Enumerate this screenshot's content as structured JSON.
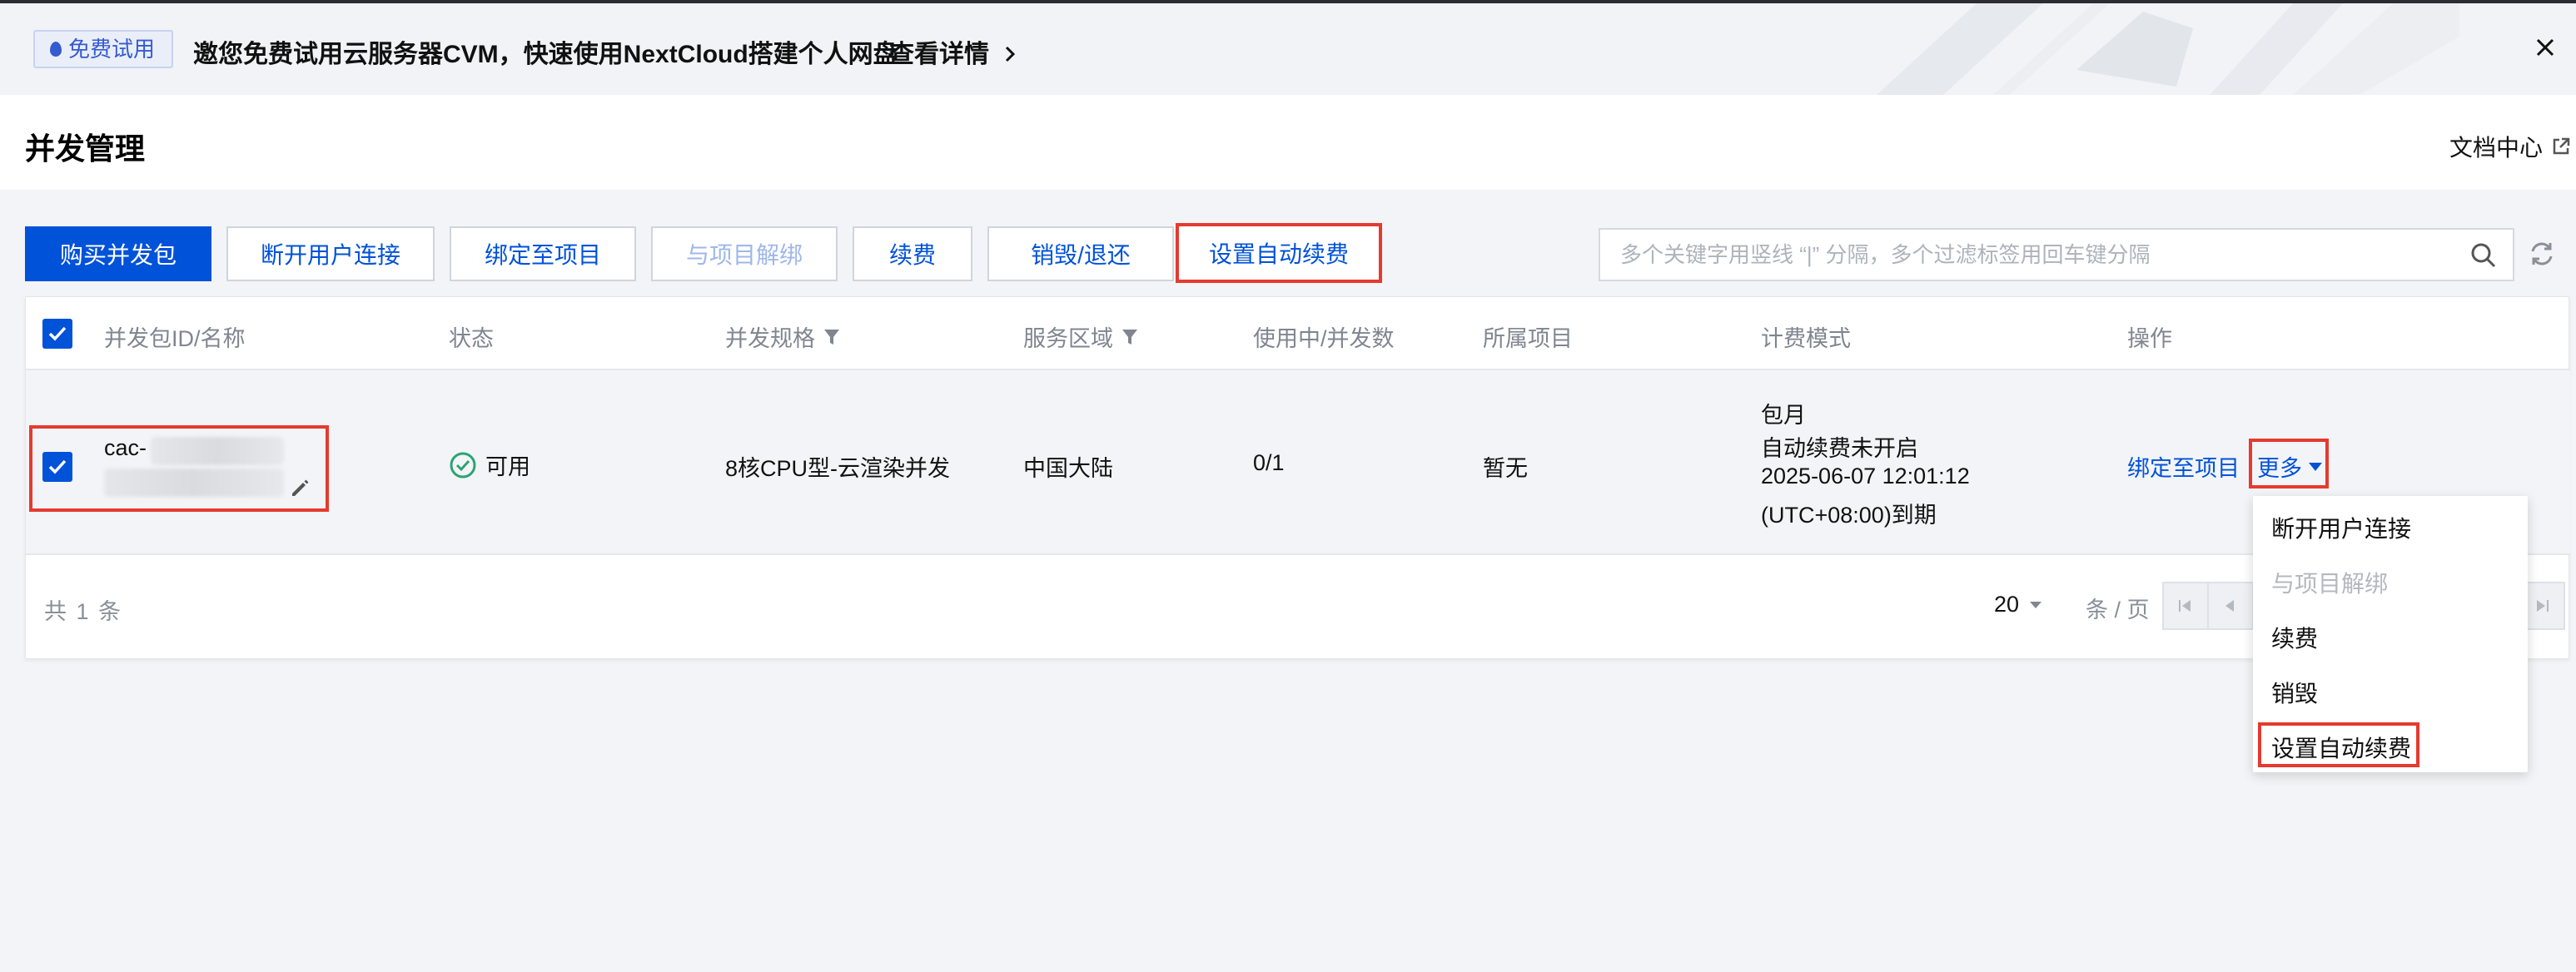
{
  "banner": {
    "badge": "免费试用",
    "text": "邀您免费试用云服务器CVM，快速使用NextCloud搭建个人网盘",
    "link": "查看详情",
    "icons": {
      "badge": "water-drop-icon",
      "link": "chevron-right-icon",
      "close": "close-icon"
    }
  },
  "header": {
    "title": "并发管理",
    "doc_link": "文档中心",
    "doc_icon": "external-link-icon"
  },
  "toolbar": {
    "buy": "购买并发包",
    "disconnect": "断开用户连接",
    "bind": "绑定至项目",
    "unbind": "与项目解绑",
    "renew": "续费",
    "destroy": "销毁/退还",
    "auto_renew": "设置自动续费"
  },
  "search": {
    "placeholder": "多个关键字用竖线 “|” 分隔，多个过滤标签用回车键分隔",
    "icon": "search-icon",
    "refresh_icon": "refresh-icon"
  },
  "table": {
    "columns": [
      "并发包ID/名称",
      "状态",
      "并发规格",
      "服务区域",
      "使用中/并发数",
      "所属项目",
      "计费模式",
      "操作"
    ],
    "rows": [
      {
        "id_prefix": "cac-",
        "status": "可用",
        "spec": "8核CPU型-云渲染并发",
        "region": "中国大陆",
        "usage": "0/1",
        "project": "暂无",
        "billing": [
          "包月",
          "自动续费未开启",
          "2025-06-07 12:01:12",
          "(UTC+08:00)到期"
        ],
        "actions": {
          "bind": "绑定至项目",
          "more": "更多"
        }
      }
    ],
    "total": "共 1 条",
    "page_size": "20",
    "per_page": "条 / 页"
  },
  "dropdown": [
    "断开用户连接",
    "与项目解绑",
    "续费",
    "销毁",
    "设置自动续费"
  ],
  "colors": {
    "primary": "#0052d9",
    "highlight": "#e53a2f",
    "success": "#2ba471"
  }
}
